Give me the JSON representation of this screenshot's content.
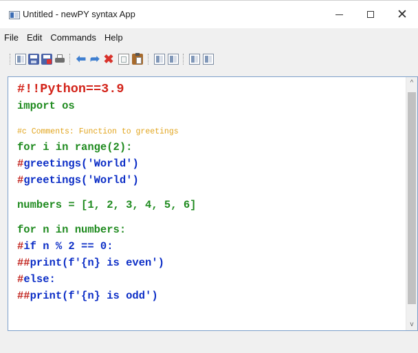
{
  "window": {
    "title": "Untitled - newPY syntax App",
    "icon": "app-window-icon",
    "controls": {
      "minimize": "minimize-icon",
      "maximize": "maximize-icon",
      "close": "close-icon",
      "close_glyph": "✕"
    }
  },
  "menu": [
    {
      "label": "File"
    },
    {
      "label": "Edit"
    },
    {
      "label": "Commands"
    },
    {
      "label": "Help"
    }
  ],
  "toolbar": {
    "icons": [
      "new-file-icon",
      "save-icon",
      "save-as-icon",
      "print-icon",
      "undo-icon",
      "redo-icon",
      "cut-icon",
      "copy-icon",
      "paste-icon",
      "document-icon",
      "document-icon",
      "document-icon",
      "document-icon"
    ],
    "undo_glyph": "⬅",
    "redo_glyph": "➦",
    "cut_glyph": "✖"
  },
  "editor": {
    "lines": [
      {
        "segments": [
          {
            "text": "#!!Python==3.9",
            "style": "shebang"
          }
        ]
      },
      {
        "segments": [
          {
            "text": "import os",
            "style": "kw"
          }
        ]
      },
      {
        "blank": true
      },
      {
        "segments": [
          {
            "text": "#c Comments: Function to greetings",
            "style": "comment"
          }
        ]
      },
      {
        "segments": [
          {
            "text": "for i in range(2):",
            "style": "kw"
          }
        ]
      },
      {
        "segments": [
          {
            "text": "#",
            "style": "hash"
          },
          {
            "text": "greetings('World')",
            "style": "call"
          }
        ]
      },
      {
        "segments": [
          {
            "text": "#",
            "style": "hash"
          },
          {
            "text": "greetings('World')",
            "style": "call"
          }
        ]
      },
      {
        "blank": true
      },
      {
        "segments": [
          {
            "text": "numbers = [1, 2, 3, 4, 5, 6]",
            "style": "kw"
          }
        ]
      },
      {
        "blank": true
      },
      {
        "segments": [
          {
            "text": "for n in numbers:",
            "style": "kw"
          }
        ]
      },
      {
        "segments": [
          {
            "text": "#",
            "style": "hash"
          },
          {
            "text": "if n % 2 == 0:",
            "style": "call"
          }
        ]
      },
      {
        "segments": [
          {
            "text": "##",
            "style": "hash"
          },
          {
            "text": "print(f'{n} is even')",
            "style": "call"
          }
        ]
      },
      {
        "segments": [
          {
            "text": "#",
            "style": "hash"
          },
          {
            "text": "else:",
            "style": "call"
          }
        ]
      },
      {
        "segments": [
          {
            "text": "##",
            "style": "hash"
          },
          {
            "text": "print(f'{n} is odd')",
            "style": "call"
          }
        ]
      }
    ],
    "scrollbar": {
      "up_glyph": "^",
      "down_glyph": "v"
    }
  },
  "colors": {
    "shebang": "#d3241a",
    "keyword": "#1e8a1e",
    "hash": "#c0201a",
    "call": "#0b2dc6",
    "comment": "#e1a41c"
  }
}
